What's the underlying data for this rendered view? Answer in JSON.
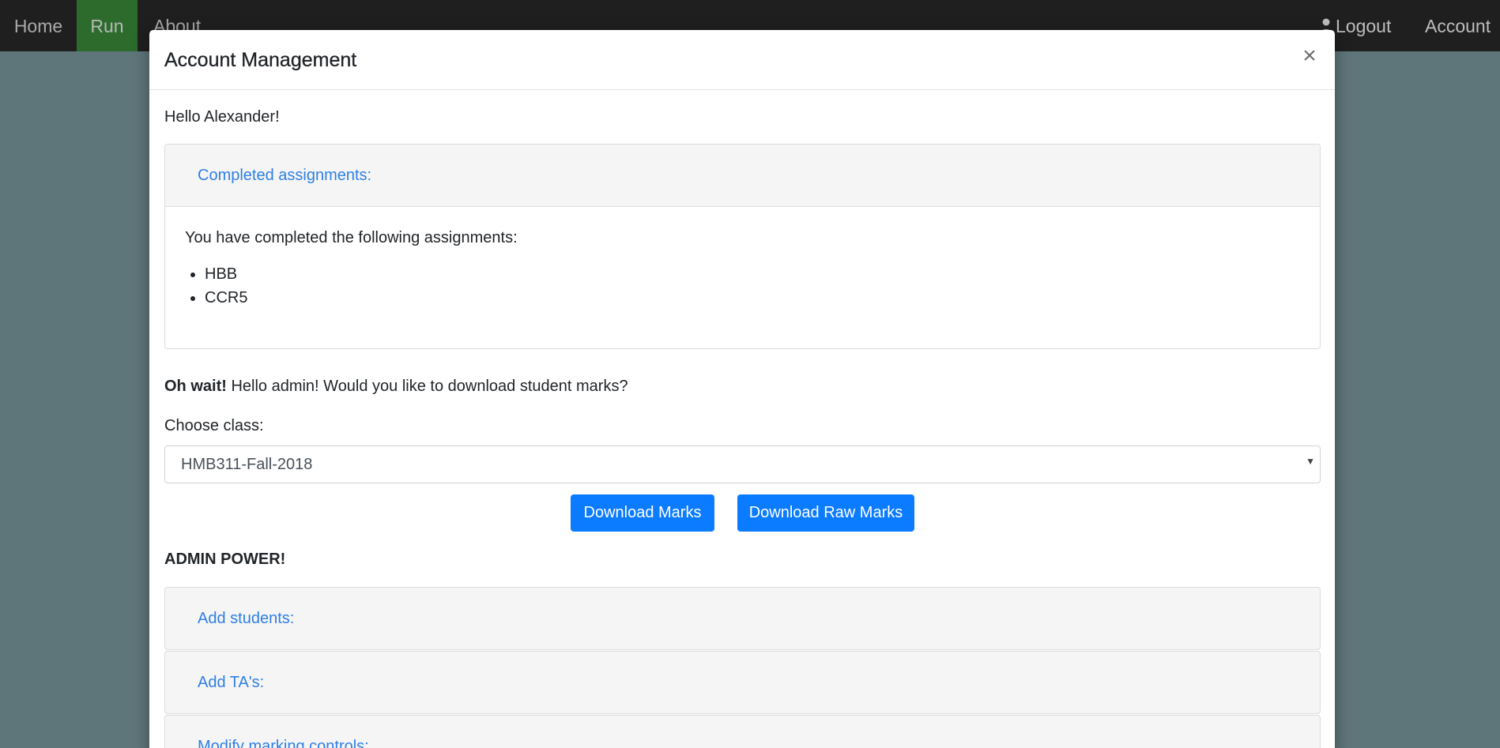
{
  "navbar": {
    "home": "Home",
    "run": "Run",
    "about": "About",
    "logout": "Logout",
    "account": "Account"
  },
  "modal": {
    "title": "Account Management",
    "close": "×",
    "greeting": "Hello Alexander!",
    "completed": {
      "heading": "Completed assignments:",
      "intro": "You have completed the following assignments:",
      "items": [
        "HBB",
        "CCR5"
      ]
    },
    "admin_prompt": {
      "bold": "Oh wait!",
      "text": "Hello admin! Would you like to download student marks?"
    },
    "choose_class_label": "Choose class:",
    "class_select": {
      "selected": "HMB311-Fall-2018"
    },
    "buttons": {
      "download_marks": "Download Marks",
      "download_raw_marks": "Download Raw Marks"
    },
    "admin_power": "ADMIN POWER!",
    "admin_sections": [
      "Add students:",
      "Add TA's:",
      "Modify marking controls:"
    ]
  },
  "colors": {
    "navbar_bg": "#1f1f1f",
    "active_nav": "#2d6b2d",
    "backdrop": "#5e757a",
    "link": "#2f80e4",
    "primary_button": "#0b7bff"
  }
}
